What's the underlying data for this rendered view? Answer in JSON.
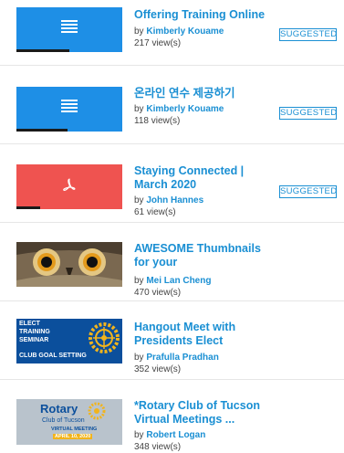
{
  "items": [
    {
      "title": "Offering Training Online",
      "by": "by",
      "author": "Kimberly Kouame",
      "views": "217 view(s)",
      "badge": "SUGGESTED"
    },
    {
      "title": "온라인 연수 제공하기",
      "by": "by",
      "author": "Kimberly Kouame",
      "views": "118 view(s)",
      "badge": "SUGGESTED"
    },
    {
      "title": "Staying Connected | March 2020",
      "by": "by",
      "author": "John Hannes",
      "views": "61 view(s)",
      "badge": "SUGGESTED"
    },
    {
      "title": "AWESOME Thumbnails for your",
      "by": "by",
      "author": "Mei Lan Cheng",
      "views": "470 view(s)"
    },
    {
      "title": "Hangout Meet with Presidents Elect",
      "by": "by",
      "author": "Prafulla Pradhan",
      "views": "352 view(s)",
      "thumb_text": [
        "ELECT",
        "TRAINING",
        "SEMINAR",
        "CLUB GOAL SETTING"
      ]
    },
    {
      "title": "*Rotary Club of Tucson Virtual Meetings ...",
      "by": "by",
      "author": "Robert Logan",
      "views": "348 view(s)",
      "thumb_text": [
        "Rotary",
        "Club of Tucson",
        "VIRTUAL MEETING",
        "APRIL 10, 2020"
      ]
    }
  ],
  "colors": {
    "link": "#1a8fd3",
    "doc_thumb": "#1e8fe6",
    "pdf_thumb": "#ef5350",
    "rotary_blue": "#0b4f9c",
    "rotary_gold": "#f2b41b"
  },
  "icons": {
    "doc": "document-icon",
    "pdf": "pdf-icon"
  }
}
